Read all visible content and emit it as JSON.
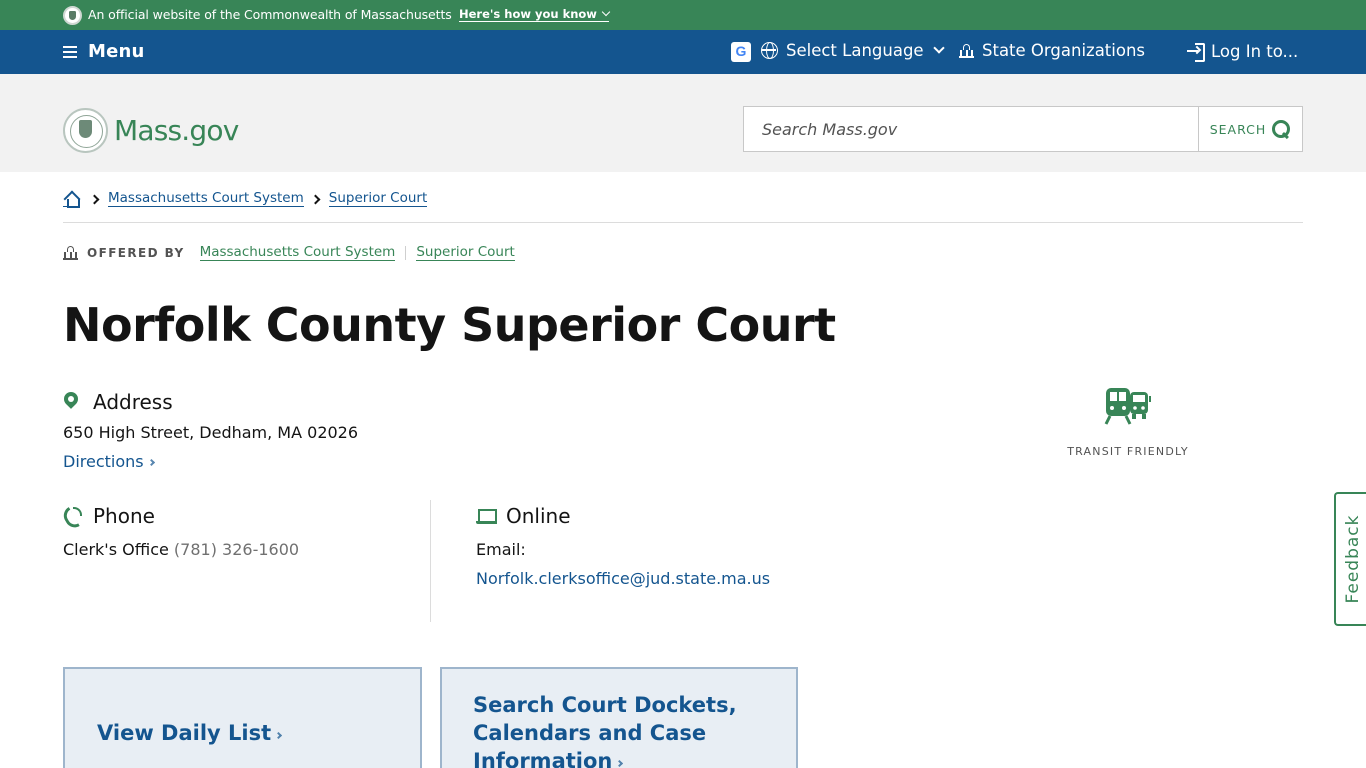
{
  "official_banner": {
    "text": "An official website of the Commonwealth of Massachusetts",
    "link": "Here's how you know"
  },
  "utility_nav": {
    "menu_label": "Menu",
    "language_label": "Select Language",
    "state_orgs_label": "State Organizations",
    "login_label": "Log In to..."
  },
  "header": {
    "logo_text": "Mass.gov",
    "search_placeholder": "Search Mass.gov",
    "search_button": "SEARCH"
  },
  "breadcrumb": {
    "items": [
      "Massachusetts Court System",
      "Superior Court"
    ]
  },
  "offered_by": {
    "label": "OFFERED BY",
    "orgs": [
      "Massachusetts Court System",
      "Superior Court"
    ]
  },
  "page": {
    "title": "Norfolk County Superior Court"
  },
  "address": {
    "heading": "Address",
    "value": "650 High Street, Dedham, MA 02026",
    "directions": "Directions"
  },
  "phone": {
    "heading": "Phone",
    "label": "Clerk's Office",
    "number": "(781) 326-1600"
  },
  "online": {
    "heading": "Online",
    "email_label": "Email:",
    "email": "Norfolk.clerksoffice@jud.state.ma.us"
  },
  "transit": {
    "label": "TRANSIT FRIENDLY"
  },
  "feedback": {
    "label": "Feedback"
  },
  "cards": [
    {
      "title": "View Daily List"
    },
    {
      "title_lines": [
        "Search Court Dockets,",
        "Calendars and Case",
        "Information"
      ]
    }
  ],
  "colors": {
    "green": "#388557",
    "blue": "#14558f",
    "header_bg": "#f2f2f2"
  }
}
